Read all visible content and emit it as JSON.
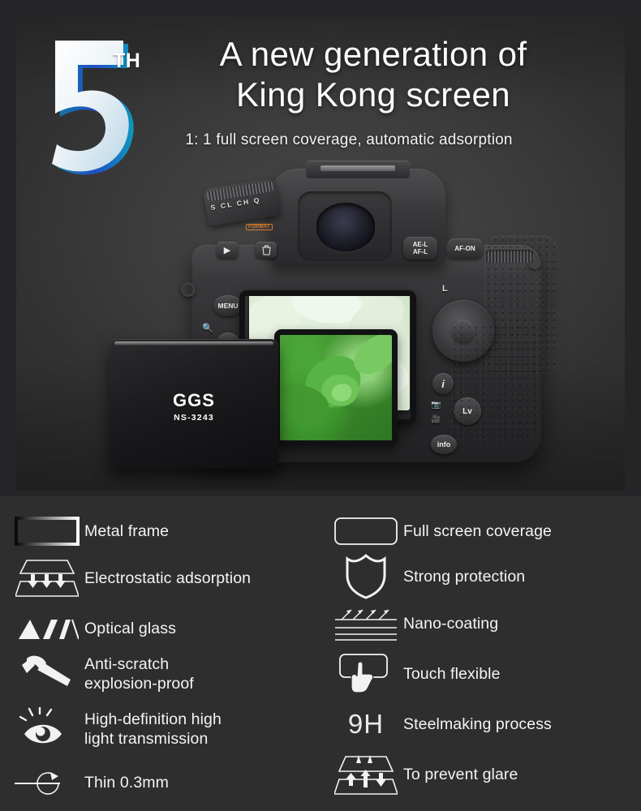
{
  "hero": {
    "anniversary_number": "5",
    "anniversary_suffix": "TH",
    "headline_line1": "A new generation of",
    "headline_line2": "King Kong screen",
    "subhead": "1: 1 full screen coverage, automatic adsorption",
    "accent_color": "#11b5c9",
    "panel_bg": "#3c3c3c"
  },
  "product": {
    "brand": "GGS",
    "model": "NS-3243"
  },
  "camera": {
    "drive_dial_letters": "S  CL  CH  Q",
    "format_badge": "FORMAT",
    "playback_icon": "▶",
    "delete_icon": "Ὕ1",
    "menu_button": "MENU",
    "help_button": "?",
    "ae_af_lock_line1": "AE-L",
    "ae_af_lock_line2": "AF-L",
    "af_on_button": "AF-ON",
    "lock_label": "L",
    "info_button": "i",
    "live_view_button": "Lv",
    "info_lower_button": "info"
  },
  "features": {
    "left": [
      {
        "icon": "metal-frame-icon",
        "label": "Metal frame"
      },
      {
        "icon": "electrostatic-adsorption-icon",
        "label": "Electrostatic adsorption"
      },
      {
        "icon": "optical-glass-icon",
        "label": "Optical glass"
      },
      {
        "icon": "anti-scratch-hammer-icon",
        "label": "Anti-scratch\nexplosion-proof"
      },
      {
        "icon": "high-definition-eye-icon",
        "label": "High-definition high\n light transmission"
      },
      {
        "icon": "thin-measure-icon",
        "label": "Thin 0.3mm"
      }
    ],
    "right": [
      {
        "icon": "full-screen-coverage-icon",
        "label": "Full screen coverage"
      },
      {
        "icon": "shield-protection-icon",
        "label": "Strong protection"
      },
      {
        "icon": "nano-coating-icon",
        "label": "Nano-coating"
      },
      {
        "icon": "touch-flexible-icon",
        "label": "Touch flexible"
      },
      {
        "icon": "hardness-9h-icon",
        "label": "Steelmaking process",
        "badge": "9H"
      },
      {
        "icon": "prevent-glare-icon",
        "label": "To prevent glare"
      }
    ]
  }
}
